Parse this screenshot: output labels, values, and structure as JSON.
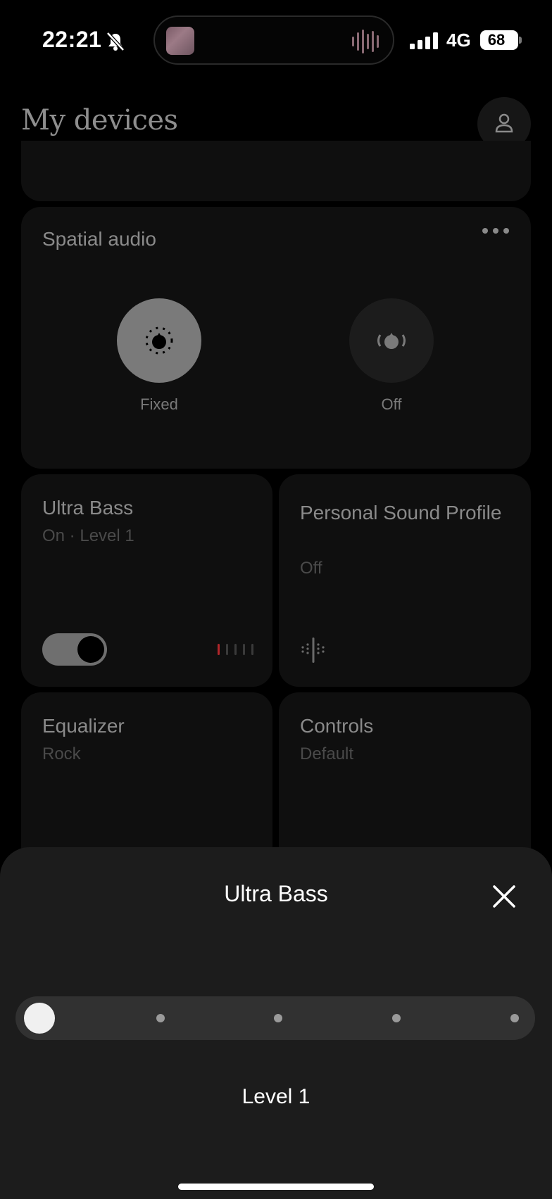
{
  "status_bar": {
    "time": "22:21",
    "network": "4G",
    "battery": "68"
  },
  "page": {
    "title": "My devices"
  },
  "spatial_audio": {
    "title": "Spatial audio",
    "options": [
      {
        "label": "Fixed",
        "selected": true
      },
      {
        "label": "Off",
        "selected": false
      }
    ]
  },
  "tiles": {
    "ultra_bass": {
      "title": "Ultra Bass",
      "subtitle": "On · Level 1",
      "enabled": true
    },
    "personal_sound": {
      "title": "Personal Sound Profile",
      "subtitle": "Off"
    },
    "equalizer": {
      "title": "Equalizer",
      "subtitle": "Rock"
    },
    "controls": {
      "title": "Controls",
      "subtitle": "Default"
    }
  },
  "sheet": {
    "title": "Ultra Bass",
    "level_label": "Level 1",
    "slider": {
      "steps": 5,
      "selected_step": 1
    }
  },
  "colors": {
    "accent_red": "#b0262a"
  }
}
